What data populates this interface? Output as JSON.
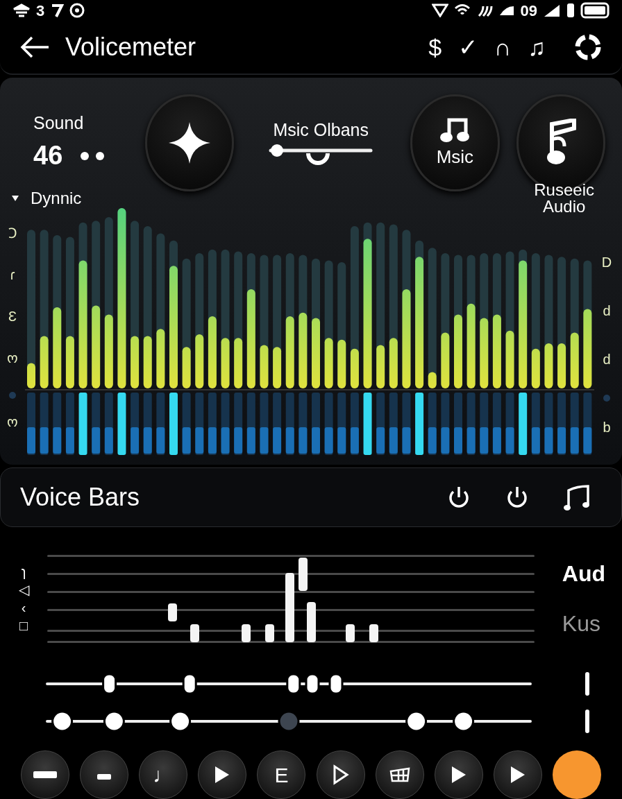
{
  "status_bar": {
    "left_text": "3",
    "right_text": "09"
  },
  "app_bar": {
    "title": "Volicemeter",
    "actions": [
      {
        "glyph": "$"
      },
      {
        "glyph": "✓"
      },
      {
        "glyph": "∩"
      },
      {
        "glyph": "♫"
      }
    ]
  },
  "header": {
    "sound_label": "Sound",
    "sound_value": "46",
    "music_label": "Msic Olbans",
    "music_slider": {
      "level": 0.05
    },
    "music_button": {
      "label": "Msic"
    },
    "right_label": [
      "Ruseeic",
      "Audio"
    ]
  },
  "spectrum": {
    "title": "Dynnic",
    "expanded": true,
    "left_labels": [
      "Ↄ",
      "ɾ",
      "Ɛ",
      "ო"
    ],
    "left_bottom_label": "ო",
    "right_labels": [
      "D",
      "d",
      "d"
    ],
    "right_bottom_label": "b"
  },
  "voice_bars": {
    "title": "Voice Bars",
    "left_labels": [
      "ɿ",
      "◁",
      "‹",
      "□"
    ],
    "legend": [
      {
        "label": "Aud",
        "selected": true
      },
      {
        "label": "Kus",
        "selected": false
      }
    ]
  },
  "sliders": [
    {
      "kind": "pill",
      "thumbs": [
        {
          "level": 0.12
        },
        {
          "level": 0.29
        },
        {
          "level": 0.51
        },
        {
          "level": 0.55
        },
        {
          "level": 0.6
        }
      ]
    },
    {
      "kind": "round",
      "thumbs": [
        {
          "level": 0.02
        },
        {
          "level": 0.13
        },
        {
          "level": 0.27
        },
        {
          "level": 0.5,
          "disabled": true
        },
        {
          "level": 0.77
        },
        {
          "level": 0.87
        }
      ]
    }
  ],
  "buttons": [
    {
      "kind": "bar"
    },
    {
      "kind": "small-bar"
    },
    {
      "kind": "glyph",
      "label": "♩"
    },
    {
      "kind": "play"
    },
    {
      "kind": "glyph",
      "label": "E"
    },
    {
      "kind": "play-outline"
    },
    {
      "kind": "grid"
    },
    {
      "kind": "play"
    },
    {
      "kind": "play"
    },
    {
      "kind": "record"
    }
  ]
}
